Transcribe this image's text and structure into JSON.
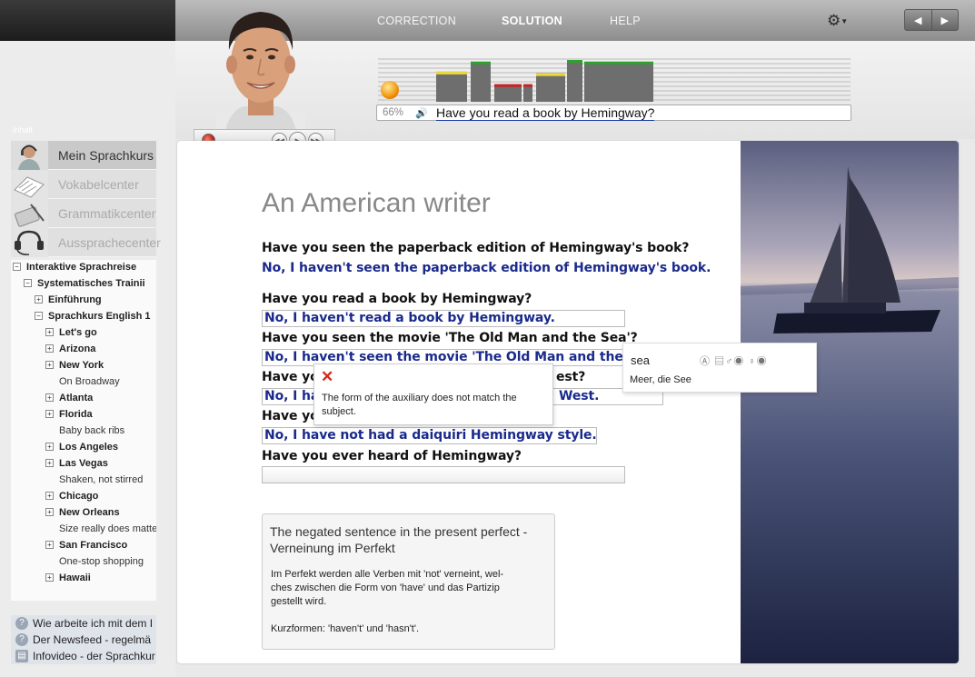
{
  "menu": {
    "correction": "CORRECTION",
    "solution": "SOLUTION",
    "help": "HELP"
  },
  "progress": {
    "percent": "66%",
    "prompt": "Have you read a book by Hemingway?",
    "bars": [
      0.72,
      0.96,
      0.42,
      0.42,
      0.68,
      1.0,
      0.96
    ]
  },
  "sidebar": {
    "label": "Inhalt",
    "modules": [
      {
        "label": "Mein Sprachkurs",
        "icon": "headset-person-icon"
      },
      {
        "label": "Vokabelcenter",
        "icon": "vocabulary-icon"
      },
      {
        "label": "Grammatikcenter",
        "icon": "grammar-icon"
      },
      {
        "label": "Aussprachecenter",
        "icon": "pronunciation-icon"
      }
    ],
    "tree": [
      {
        "text": "Interaktive Sprachreise",
        "lvl": 0,
        "pm": "-",
        "bold": true
      },
      {
        "text": "Systematisches Trainii",
        "lvl": 1,
        "pm": "-",
        "bold": true
      },
      {
        "text": "Einführung",
        "lvl": 2,
        "pm": "+",
        "bold": true
      },
      {
        "text": "Sprachkurs English 1",
        "lvl": 2,
        "pm": "-",
        "bold": true
      },
      {
        "text": "Let's go",
        "lvl": 3,
        "pm": "+",
        "bold": true
      },
      {
        "text": "Arizona",
        "lvl": 3,
        "pm": "+",
        "bold": true
      },
      {
        "text": "New York",
        "lvl": 3,
        "pm": "+",
        "bold": true
      },
      {
        "text": "On Broadway",
        "lvl": 4,
        "pm": "",
        "bold": false
      },
      {
        "text": "Atlanta",
        "lvl": 3,
        "pm": "+",
        "bold": true
      },
      {
        "text": "Florida",
        "lvl": 3,
        "pm": "+",
        "bold": true
      },
      {
        "text": "Baby back ribs",
        "lvl": 4,
        "pm": "",
        "bold": false
      },
      {
        "text": "Los Angeles",
        "lvl": 3,
        "pm": "+",
        "bold": true
      },
      {
        "text": "Las Vegas",
        "lvl": 3,
        "pm": "+",
        "bold": true
      },
      {
        "text": "Shaken, not stirred",
        "lvl": 4,
        "pm": "",
        "bold": false
      },
      {
        "text": "Chicago",
        "lvl": 3,
        "pm": "+",
        "bold": true
      },
      {
        "text": "New Orleans",
        "lvl": 3,
        "pm": "+",
        "bold": true
      },
      {
        "text": "Size really does matte",
        "lvl": 4,
        "pm": "",
        "bold": false
      },
      {
        "text": "San Francisco",
        "lvl": 3,
        "pm": "+",
        "bold": true
      },
      {
        "text": "One-stop shopping",
        "lvl": 4,
        "pm": "",
        "bold": false
      },
      {
        "text": "Hawaii",
        "lvl": 3,
        "pm": "+",
        "bold": true
      }
    ],
    "help_links": [
      {
        "text": "Wie arbeite ich mit dem I",
        "icon": "help-icon"
      },
      {
        "text": "Der Newsfeed - regelmä",
        "icon": "help-icon"
      },
      {
        "text": "Infovideo - der Sprachkur",
        "icon": "video-icon"
      }
    ]
  },
  "lesson": {
    "title": "An American writer",
    "q1": "Have you seen the paperback edition of Hemingway's book?",
    "a1": "No, I haven't seen the paperback edition of Hemingway's book.",
    "q2": "Have you read a book by Hemingway?",
    "a2": "No, I haven't read a book by Hemingway.",
    "q3": "Have you seen the movie 'The Old Man and the Sea'?",
    "a3": "No, I haven't seen the movie 'The Old Man and the Sea'.",
    "q4_start": "Have yo",
    "q4_end": "est?",
    "a4_start": "No, I hav",
    "a4_end": "West.",
    "q5_start": "Have yo",
    "a5": "No, I have not had a daiquiri Hemingway style.",
    "q6": "Have you ever heard of Hemingway?",
    "a6": ""
  },
  "error_popup": {
    "message": "The form of the auxiliary does not match the subject."
  },
  "dictionary": {
    "word": "sea",
    "translation": "Meer, die See"
  },
  "grammar_box": {
    "title": "The negated sentence in the present perfect - Verneinung im Perfekt",
    "body": "Im Perfekt werden alle Verben mit 'not' verneint, wel-\nches zwischen die Form von 'have' und das Partizip\ngestellt wird.",
    "footer": "Kurzformen: 'haven't' und 'hasn't'."
  },
  "colors": {
    "answer": "#1a2a8c",
    "error": "#d6281a",
    "bar_green": "#2fa12f",
    "bar_red": "#cc2222",
    "bar_yellow": "#e8d83a"
  }
}
